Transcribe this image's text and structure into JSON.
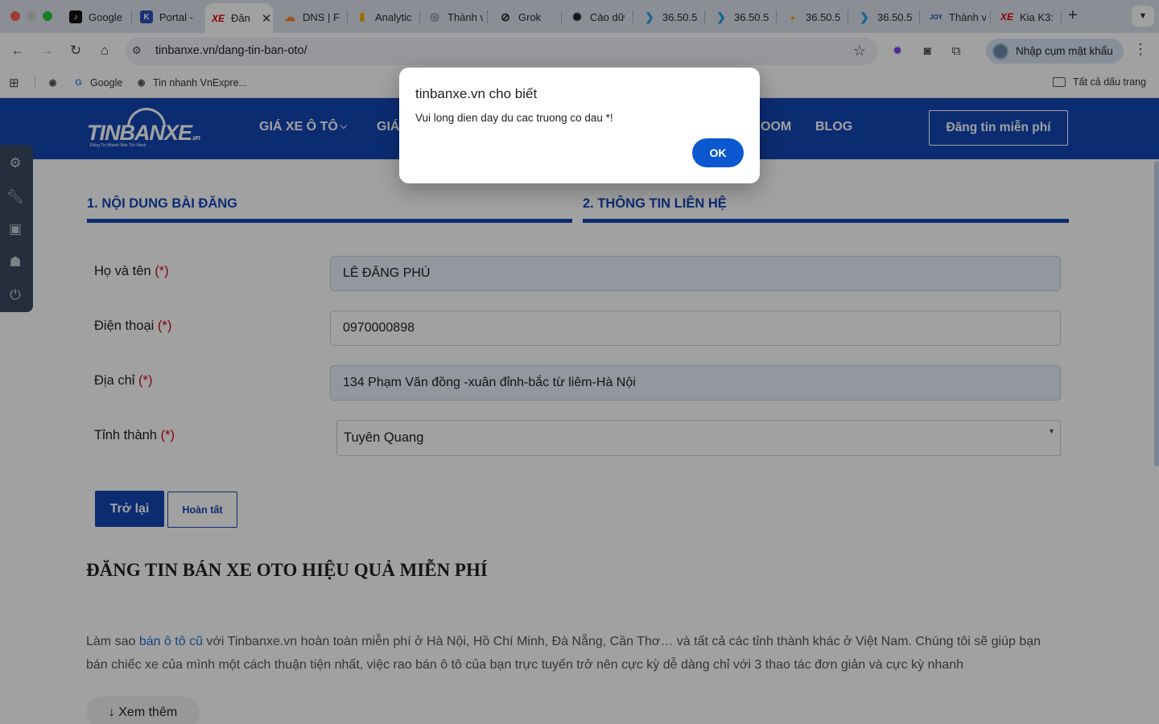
{
  "browser": {
    "tabs": [
      {
        "title": "Google",
        "icon": "tiktok-icon",
        "color": "#111111"
      },
      {
        "title": "Portal -",
        "icon": "k-icon",
        "color": "#2a4fb8"
      },
      {
        "title": "Đăn",
        "icon": "xe-icon",
        "color": "#d90000"
      },
      {
        "title": "DNS | F",
        "icon": "cloudflare-icon",
        "color": "#f38020"
      },
      {
        "title": "Analytic",
        "icon": "analytics-icon",
        "color": "#f9ab00"
      },
      {
        "title": "Thành v",
        "icon": "globe-icon",
        "color": "#888888"
      },
      {
        "title": "Grok",
        "icon": "grok-icon",
        "color": "#222222"
      },
      {
        "title": "Cào dữ",
        "icon": "openai-icon",
        "color": "#222222"
      },
      {
        "title": "36.50.5",
        "icon": "arrow-icon",
        "color": "#1aa3e8"
      },
      {
        "title": "36.50.5",
        "icon": "arrow-icon",
        "color": "#1aa3e8"
      },
      {
        "title": "36.50.5",
        "icon": "pma-icon",
        "color": "#f5a000"
      },
      {
        "title": "36.50.5",
        "icon": "arrow-icon",
        "color": "#1aa3e8"
      },
      {
        "title": "Thành v",
        "icon": "joy-icon",
        "color": "#1a4fa0"
      },
      {
        "title": "Kia K3:",
        "icon": "xe-icon",
        "color": "#d90000"
      }
    ],
    "active_tab_index": 2,
    "new_tab": "+",
    "address_url": "tinbanxe.vn/dang-tin-ban-oto/",
    "profile_label": "Nhập cụm mật khẩu",
    "bookmarks": [
      {
        "label": "Google",
        "icon": "google-icon"
      },
      {
        "label": "Tin nhanh VnExpre...",
        "icon": "globe-icon"
      }
    ],
    "all_bookmarks_label": "Tất cả dấu trang"
  },
  "site": {
    "logo_text": "TINBANXE",
    "logo_suffix": ".vn",
    "logo_sub": "Đăng Tin Nhanh Bán Tốc Hành",
    "nav": [
      {
        "label": "GIÁ XE Ô TÔ",
        "chevron": "⌵"
      },
      {
        "label": "GIÁ"
      },
      {
        "label": "OOM"
      },
      {
        "label": "BLOG"
      }
    ],
    "post_button": "Đăng tin miễn phí",
    "brand_color": "#1447b5"
  },
  "form": {
    "step1": "1. NỘI DUNG BÀI ĐĂNG",
    "step2": "2. THÔNG TIN LIÊN HỆ",
    "required_mark": "(*)",
    "fields": {
      "name": {
        "label": "Họ và tên",
        "value": "LÊ ĐĂNG PHÚ"
      },
      "phone": {
        "label": "Điện thoại",
        "value": "0970000898"
      },
      "address": {
        "label": "Địa chỉ",
        "value": "134 Phạm Văn đồng -xuân đỉnh-bắc từ liêm-Hà Nội"
      },
      "province": {
        "label": "Tỉnh thành",
        "value": "Tuyên Quang"
      }
    },
    "back_button": "Trở lại",
    "done_button": "Hoàn tất"
  },
  "article": {
    "title": "ĐĂNG TIN BÁN XE OTO HIỆU QUẢ MIỄN PHÍ",
    "intro_pre": "Làm sao ",
    "intro_link": "bán ô tô cũ",
    "intro_post": " với Tinbanxe.vn hoàn toàn miễn phí ở Hà Nội, Hồ Chí Minh, Đà Nẵng, Cần Thơ… và tất cả các tỉnh thành khác ở Việt Nam. Chúng tôi sẽ giúp bạn bán chiếc xe của mình một cách thuận tiện nhất, việc rao bán ô tô của bạn trực tuyến trở nên cực kỳ dễ dàng chỉ với 3 thao tác đơn giản và cực kỳ nhanh",
    "read_more": "↓ Xem thêm"
  },
  "alert": {
    "title": "tinbanxe.vn cho biết",
    "message": "Vui long dien day du cac truong co dau *!",
    "ok": "OK"
  }
}
